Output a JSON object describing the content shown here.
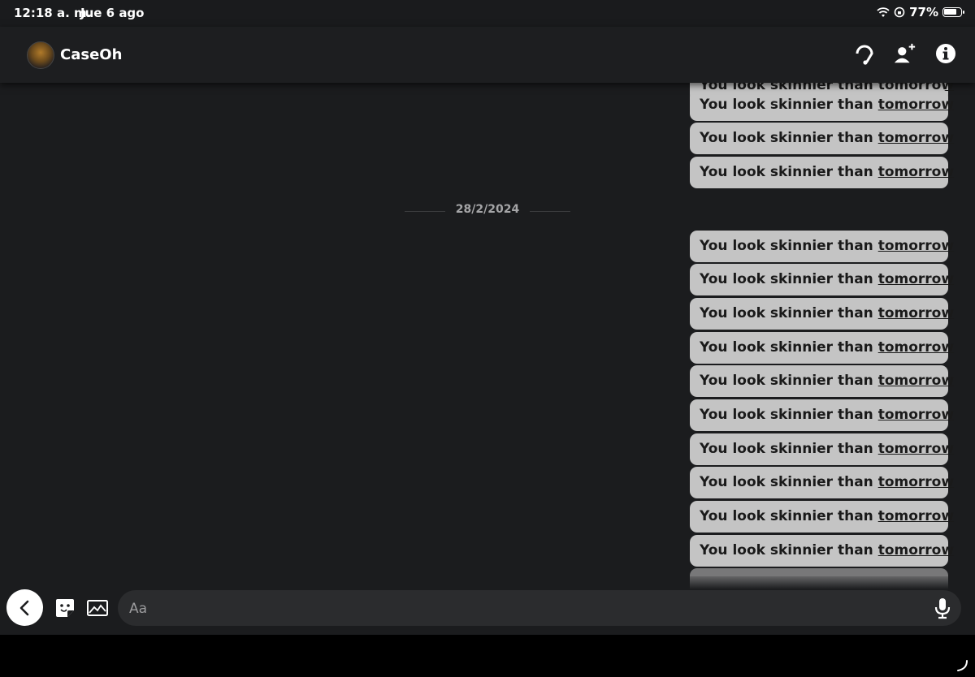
{
  "status_bar": {
    "time": "12:18 a. m.",
    "date": "Jue 6 ago",
    "battery": "77%"
  },
  "header": {
    "contact_name": "CaseOh",
    "icons": [
      "headset-icon",
      "add-friend-icon",
      "info-icon"
    ]
  },
  "chat": {
    "date_separator": "28/2/2024",
    "message_text": "You look skinnier than ",
    "message_link": "tomorrow",
    "messages_before": 3,
    "messages_after": 10
  },
  "composer": {
    "placeholder": "Aa",
    "value": ""
  },
  "colors": {
    "background": "#1b1c1e",
    "bubble": "#c4c4c4",
    "header": "#1d1e20",
    "input": "#2b2c2e"
  }
}
